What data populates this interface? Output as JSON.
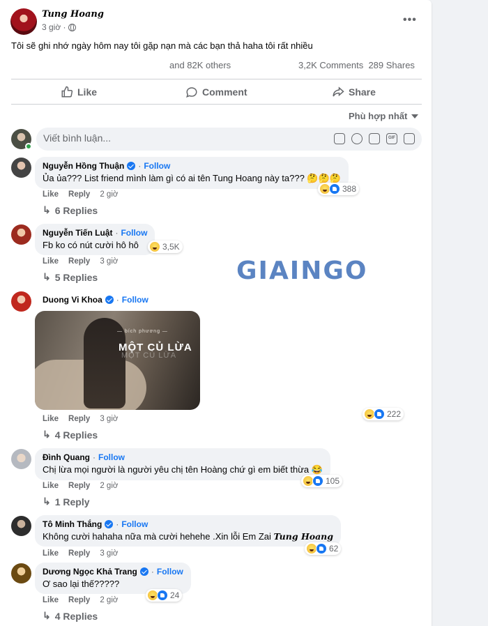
{
  "post": {
    "author": "Tung Hoang",
    "time": "3 giờ ·",
    "text": "Tôi sẽ ghi nhớ ngày hôm nay tôi gặp nạn mà các bạn thả haha tôi rất nhiều",
    "reactions_summary": "and 82K others",
    "comments_count": "3,2K Comments",
    "shares_count": "289 Shares"
  },
  "actions": {
    "like": "Like",
    "comment": "Comment",
    "share": "Share"
  },
  "sort_label": "Phù hợp nhất",
  "composer": {
    "placeholder": "Viết bình luận..."
  },
  "watermark": "GIAINGO",
  "comments": [
    {
      "name": "Nguyễn Hồng Thuận",
      "verified": true,
      "follow": "Follow",
      "text": "Ủa ủa??? List friend mình làm gì có ai tên Tung Hoang này ta??? 🤔🤔🤔",
      "reactions": "388",
      "like": "Like",
      "reply": "Reply",
      "time": "2 giờ",
      "replies": "6 Replies"
    },
    {
      "name": "Nguyễn Tiến Luật",
      "verified": false,
      "follow": "Follow",
      "text": "Fb ko có nút cười hô hô",
      "reactions": "3,5K",
      "like": "Like",
      "reply": "Reply",
      "time": "3 giờ",
      "replies": "5 Replies"
    },
    {
      "name": "Duong Vi Khoa",
      "verified": true,
      "follow": "Follow",
      "photo_artist": "— bích phương —",
      "photo_title": "MỘT CỦ LỪA",
      "reactions": "222",
      "like": "Like",
      "reply": "Reply",
      "time": "3 giờ",
      "replies": "4 Replies"
    },
    {
      "name": "Đình Quang",
      "verified": false,
      "follow": "Follow",
      "text": "Chị lừa mọi người là người yêu chị tên Hoàng chứ gì em biết thừa 😂",
      "reactions": "105",
      "like": "Like",
      "reply": "Reply",
      "time": "2 giờ",
      "replies": "1 Reply"
    },
    {
      "name": "Tô Minh Thắng",
      "verified": true,
      "follow": "Follow",
      "text": "Không cười hahaha nữa mà cười hehehe .Xin lỗi Em Zai",
      "tag": "Tung Hoang",
      "reactions": "62",
      "like": "Like",
      "reply": "Reply",
      "time": "3 giờ"
    },
    {
      "name": "Dương Ngọc Khả Trang",
      "verified": true,
      "follow": "Follow",
      "text": "Ơ sao lại thế?????",
      "reactions": "24",
      "like": "Like",
      "reply": "Reply",
      "time": "2 giờ",
      "replies": "4 Replies"
    }
  ]
}
